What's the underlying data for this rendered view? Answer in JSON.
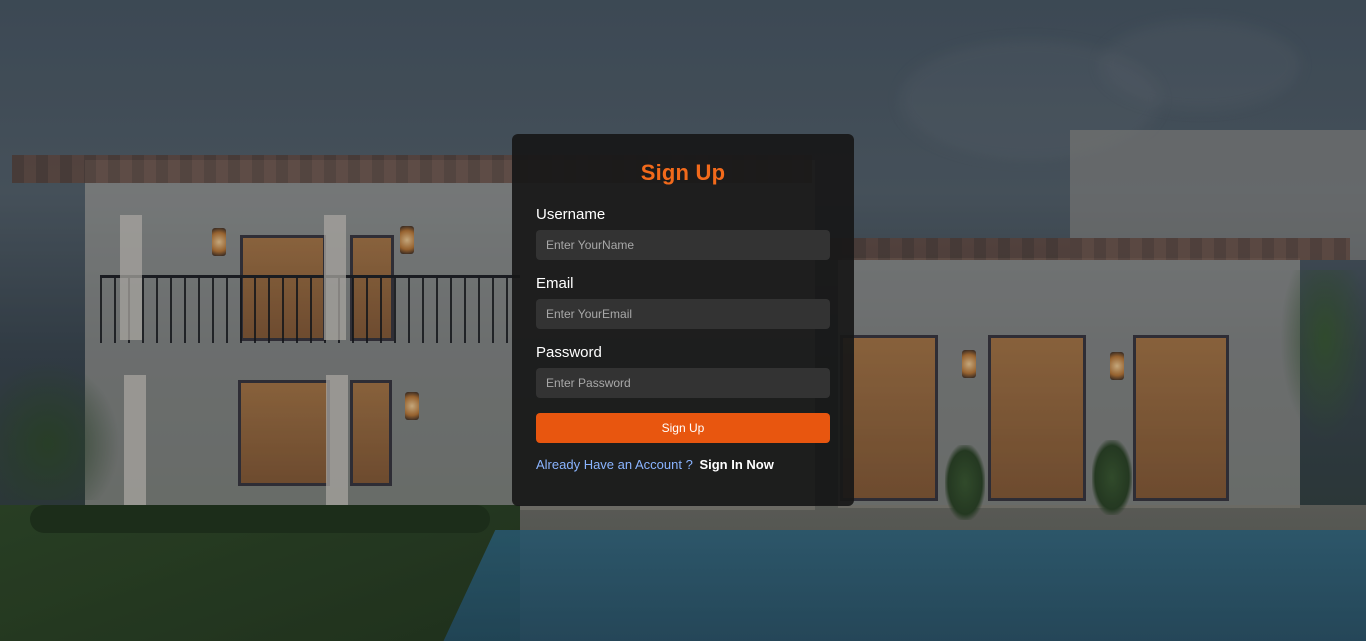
{
  "signup_form": {
    "title": "Sign Up",
    "username": {
      "label": "Username",
      "placeholder": "Enter YourName",
      "value": ""
    },
    "email": {
      "label": "Email",
      "placeholder": "Enter YourEmail",
      "value": ""
    },
    "password": {
      "label": "Password",
      "placeholder": "Enter Password",
      "value": ""
    },
    "submit_label": "Sign Up",
    "signin_prompt": "Already Have an Account ?",
    "signin_link": "Sign In Now"
  },
  "colors": {
    "accent": "#e8560f",
    "title": "#f26a1b",
    "card_background": "#181818",
    "input_background": "#333333",
    "prompt_text": "#8ab4ff"
  }
}
